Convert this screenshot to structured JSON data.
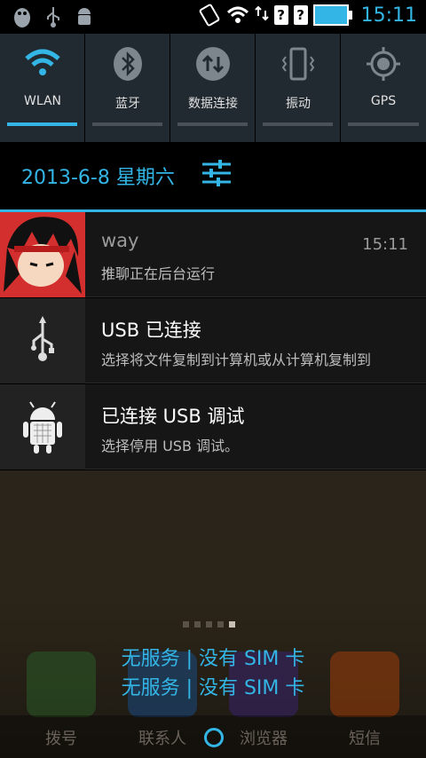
{
  "status_bar": {
    "time": "15:11",
    "icons": [
      "penguin-icon",
      "usb-icon",
      "android-icon",
      "vibrate-icon",
      "wifi-icon",
      "data-arrows-icon",
      "no-sim-icon",
      "no-sim-icon",
      "battery-charging-icon"
    ],
    "unknown_glyph": "?"
  },
  "quick_settings": {
    "tiles": [
      {
        "label": "WLAN",
        "icon": "wifi-icon",
        "on": true
      },
      {
        "label": "蓝牙",
        "icon": "bluetooth-icon",
        "on": false
      },
      {
        "label": "数据连接",
        "icon": "data-arrows-icon",
        "on": false
      },
      {
        "label": "振动",
        "icon": "vibrate-icon",
        "on": false
      },
      {
        "label": "GPS",
        "icon": "gps-icon",
        "on": false
      }
    ]
  },
  "date": "2013-6-8 星期六",
  "notifications": [
    {
      "title": "way",
      "text": "推聊正在后台运行",
      "time": "15:11",
      "icon": "avatar-icon"
    },
    {
      "title": "USB 已连接",
      "text": "选择将文件复制到计算机或从计算机复制到",
      "icon": "usb-icon"
    },
    {
      "title": "已连接 USB 调试",
      "text": "选择停用 USB 调试。",
      "icon": "android-debug-icon"
    }
  ],
  "carrier": {
    "line1": "无服务 | 没有 SIM 卡",
    "line2": "无服务 | 没有 SIM 卡"
  },
  "dock": [
    {
      "label": "拨号",
      "icon": "phone-icon"
    },
    {
      "label": "联系人",
      "icon": "contacts-icon"
    },
    {
      "label": "浏览器",
      "icon": "browser-icon"
    },
    {
      "label": "短信",
      "icon": "messaging-icon"
    }
  ],
  "colors": {
    "accent": "#33b5e5",
    "panel": "#222a31"
  },
  "page_indicator": {
    "count": 5,
    "active": 5
  }
}
